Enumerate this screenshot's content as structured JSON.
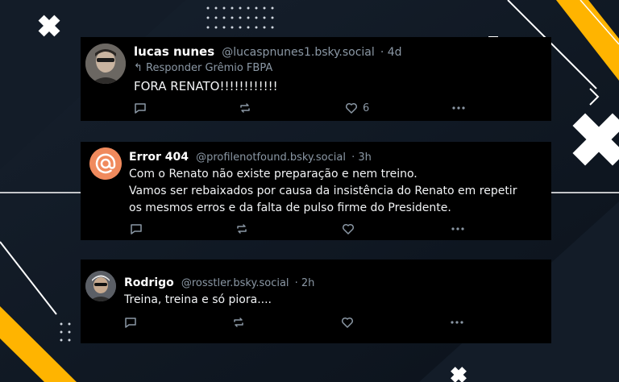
{
  "posts": [
    {
      "author": "lucas nunes",
      "handle": "@lucaspnunes1.bsky.social",
      "time": "· 4d",
      "reply_to": "Responder Grêmio FBPA",
      "text": "FORA RENATO!!!!!!!!!!!!",
      "like_count": "6"
    },
    {
      "author": "Error 404",
      "handle": "@profilenotfound.bsky.social",
      "time": "· 3h",
      "lines": [
        "Com o Renato não existe preparação e nem treino.",
        "Vamos ser rebaixados por causa da insistência do Renato em repetir",
        "os mesmos erros e da falta de pulso firme do Presidente."
      ]
    },
    {
      "author": "Rodrigo",
      "handle": "@rosstler.bsky.social",
      "time": "· 2h",
      "text": "Treina, treina e só piora...."
    }
  ],
  "colors": {
    "accent_yellow": "#ffb400",
    "avatar_orange": "#f08a5d",
    "post_bg": "#000000",
    "muted": "#8b98a5"
  },
  "icons": [
    "reply-icon",
    "comment-icon",
    "repost-icon",
    "like-icon",
    "more-icon",
    "at-icon"
  ]
}
